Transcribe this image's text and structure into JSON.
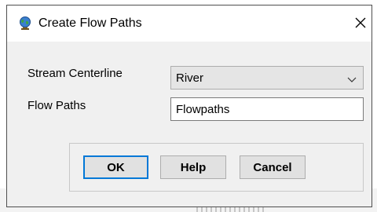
{
  "dialog": {
    "title": "Create Flow Paths",
    "icon": "globe-icon",
    "close_icon": "close-icon"
  },
  "form": {
    "stream_centerline": {
      "label": "Stream Centerline",
      "value": "River"
    },
    "flow_paths": {
      "label": "Flow Paths",
      "value": "Flowpaths"
    }
  },
  "buttons": {
    "ok": "OK",
    "help": "Help",
    "cancel": "Cancel"
  },
  "colors": {
    "focus_border": "#0078d7",
    "dialog_bg": "#f0f0f0"
  }
}
